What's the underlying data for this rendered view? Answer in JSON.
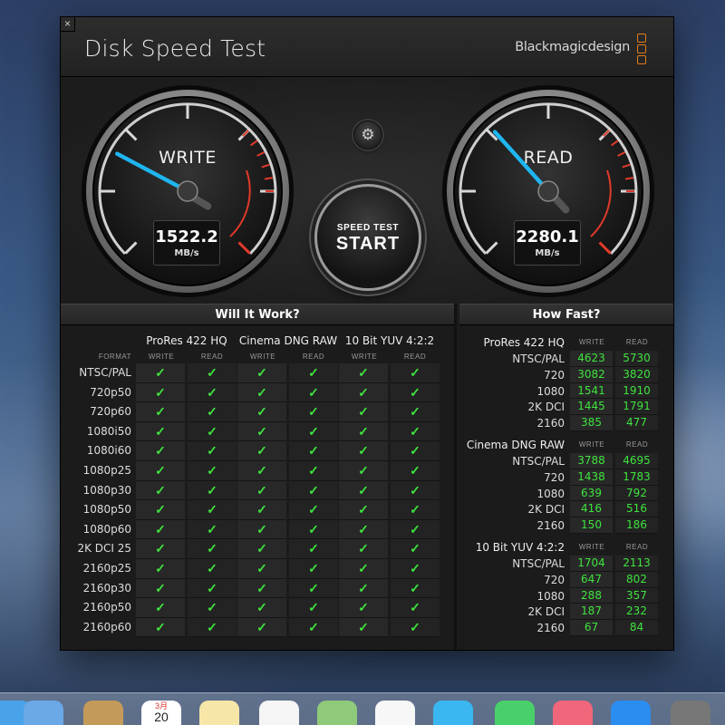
{
  "window": {
    "close_glyph": "×",
    "title": "Disk Speed Test",
    "brand": "Blackmagicdesign"
  },
  "gauges": {
    "write": {
      "label": "WRITE",
      "value": "1522.2",
      "unit": "MB/s"
    },
    "read": {
      "label": "READ",
      "value": "2280.1",
      "unit": "MB/s"
    }
  },
  "controls": {
    "settings_icon": "gear-icon",
    "start_small": "SPEED TEST",
    "start_big": "START"
  },
  "will_it_work": {
    "title": "Will It Work?",
    "format_header": "FORMAT",
    "codecs": [
      "ProRes 422 HQ",
      "Cinema DNG RAW",
      "10 Bit YUV 4:2:2"
    ],
    "write_header": "WRITE",
    "read_header": "READ",
    "check_glyph": "✓",
    "formats": [
      "NTSC/PAL",
      "720p50",
      "720p60",
      "1080i50",
      "1080i60",
      "1080p25",
      "1080p30",
      "1080p50",
      "1080p60",
      "2K DCI 25",
      "2160p25",
      "2160p30",
      "2160p50",
      "2160p60"
    ]
  },
  "how_fast": {
    "title": "How Fast?",
    "write_header": "WRITE",
    "read_header": "READ",
    "groups": [
      {
        "codec": "ProRes 422 HQ",
        "rows": [
          {
            "name": "NTSC/PAL",
            "write": "4623",
            "read": "5730"
          },
          {
            "name": "720",
            "write": "3082",
            "read": "3820"
          },
          {
            "name": "1080",
            "write": "1541",
            "read": "1910"
          },
          {
            "name": "2K DCI",
            "write": "1445",
            "read": "1791"
          },
          {
            "name": "2160",
            "write": "385",
            "read": "477"
          }
        ]
      },
      {
        "codec": "Cinema DNG RAW",
        "rows": [
          {
            "name": "NTSC/PAL",
            "write": "3788",
            "read": "4695"
          },
          {
            "name": "720",
            "write": "1438",
            "read": "1783"
          },
          {
            "name": "1080",
            "write": "639",
            "read": "792"
          },
          {
            "name": "2K DCI",
            "write": "416",
            "read": "516"
          },
          {
            "name": "2160",
            "write": "150",
            "read": "186"
          }
        ]
      },
      {
        "codec": "10 Bit YUV 4:2:2",
        "rows": [
          {
            "name": "NTSC/PAL",
            "write": "1704",
            "read": "2113"
          },
          {
            "name": "720",
            "write": "647",
            "read": "802"
          },
          {
            "name": "1080",
            "write": "288",
            "read": "357"
          },
          {
            "name": "2K DCI",
            "write": "187",
            "read": "232"
          },
          {
            "name": "2160",
            "write": "67",
            "read": "84"
          }
        ]
      }
    ]
  },
  "colors": {
    "check": "#3fe33f",
    "needle": "#1fb6f0",
    "redline": "#e03a2a",
    "brand_logo": "#e07b1a"
  },
  "dock": {
    "icons": [
      "finder-icon",
      "mail-icon",
      "contacts-icon",
      "calendar-icon",
      "notes-icon",
      "reminders-icon",
      "maps-icon",
      "photos-icon",
      "messages-icon",
      "facetime-icon",
      "itunes-icon",
      "app-store-icon",
      "system-preferences-icon"
    ],
    "calendar_month": "3月",
    "calendar_day": "20"
  }
}
